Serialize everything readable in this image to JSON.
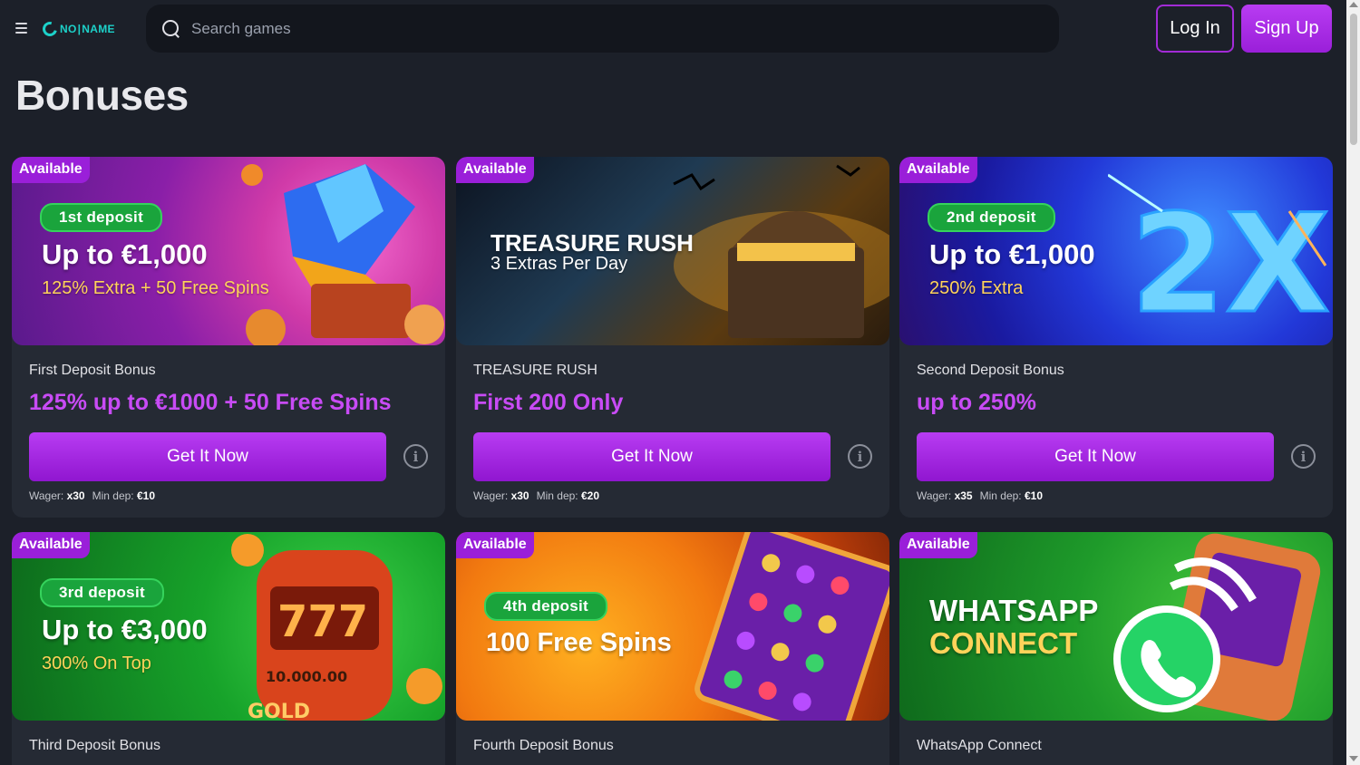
{
  "header": {
    "logo_no": "NO",
    "logo_name": "NAME",
    "search_placeholder": "Search games",
    "login_label": "Log In",
    "signup_label": "Sign Up"
  },
  "page": {
    "title": "Bonuses"
  },
  "cards": [
    {
      "badge": "Available",
      "deposit_pill": "1st deposit",
      "headline": "Up to €1,000",
      "subline": "125% Extra + 50 Free Spins",
      "name": "First Deposit Bonus",
      "offer": "125% up to €1000 + 50 Free Spins",
      "button": "Get It Now",
      "wager_label": "Wager:",
      "wager": "x30",
      "mindep_label": "Min dep:",
      "mindep": "€10"
    },
    {
      "badge": "Available",
      "headline": "TREASURE RUSH",
      "subline": "3 Extras Per Day",
      "name": "TREASURE RUSH",
      "offer": "First 200 Only",
      "button": "Get It Now",
      "wager_label": "Wager:",
      "wager": "x30",
      "mindep_label": "Min dep:",
      "mindep": "€20"
    },
    {
      "badge": "Available",
      "deposit_pill": "2nd deposit",
      "headline": "Up to €1,000",
      "subline": "250% Extra",
      "art_text": "2X",
      "name": "Second Deposit Bonus",
      "offer": "up to 250%",
      "button": "Get It Now",
      "wager_label": "Wager:",
      "wager": "x35",
      "mindep_label": "Min dep:",
      "mindep": "€10"
    },
    {
      "badge": "Available",
      "deposit_pill": "3rd deposit",
      "headline": "Up to €3,000",
      "subline": "300% On Top",
      "art_text_1": "777",
      "art_text_2": "10.000.00",
      "art_text_3": "GOLD",
      "name": "Third Deposit Bonus"
    },
    {
      "badge": "Available",
      "deposit_pill": "4th deposit",
      "headline": "100 Free Spins",
      "name": "Fourth Deposit Bonus"
    },
    {
      "badge": "Available",
      "headline_1": "WHATSAPP",
      "headline_2": "CONNECT",
      "name": "WhatsApp Connect"
    }
  ],
  "colors": {
    "background": "#1c2029",
    "card": "#252a34",
    "accent": "#9a1fd9",
    "offer_text": "#c84bf5",
    "deposit_pill": "#1aa43c",
    "logo": "#1dd1c9"
  }
}
